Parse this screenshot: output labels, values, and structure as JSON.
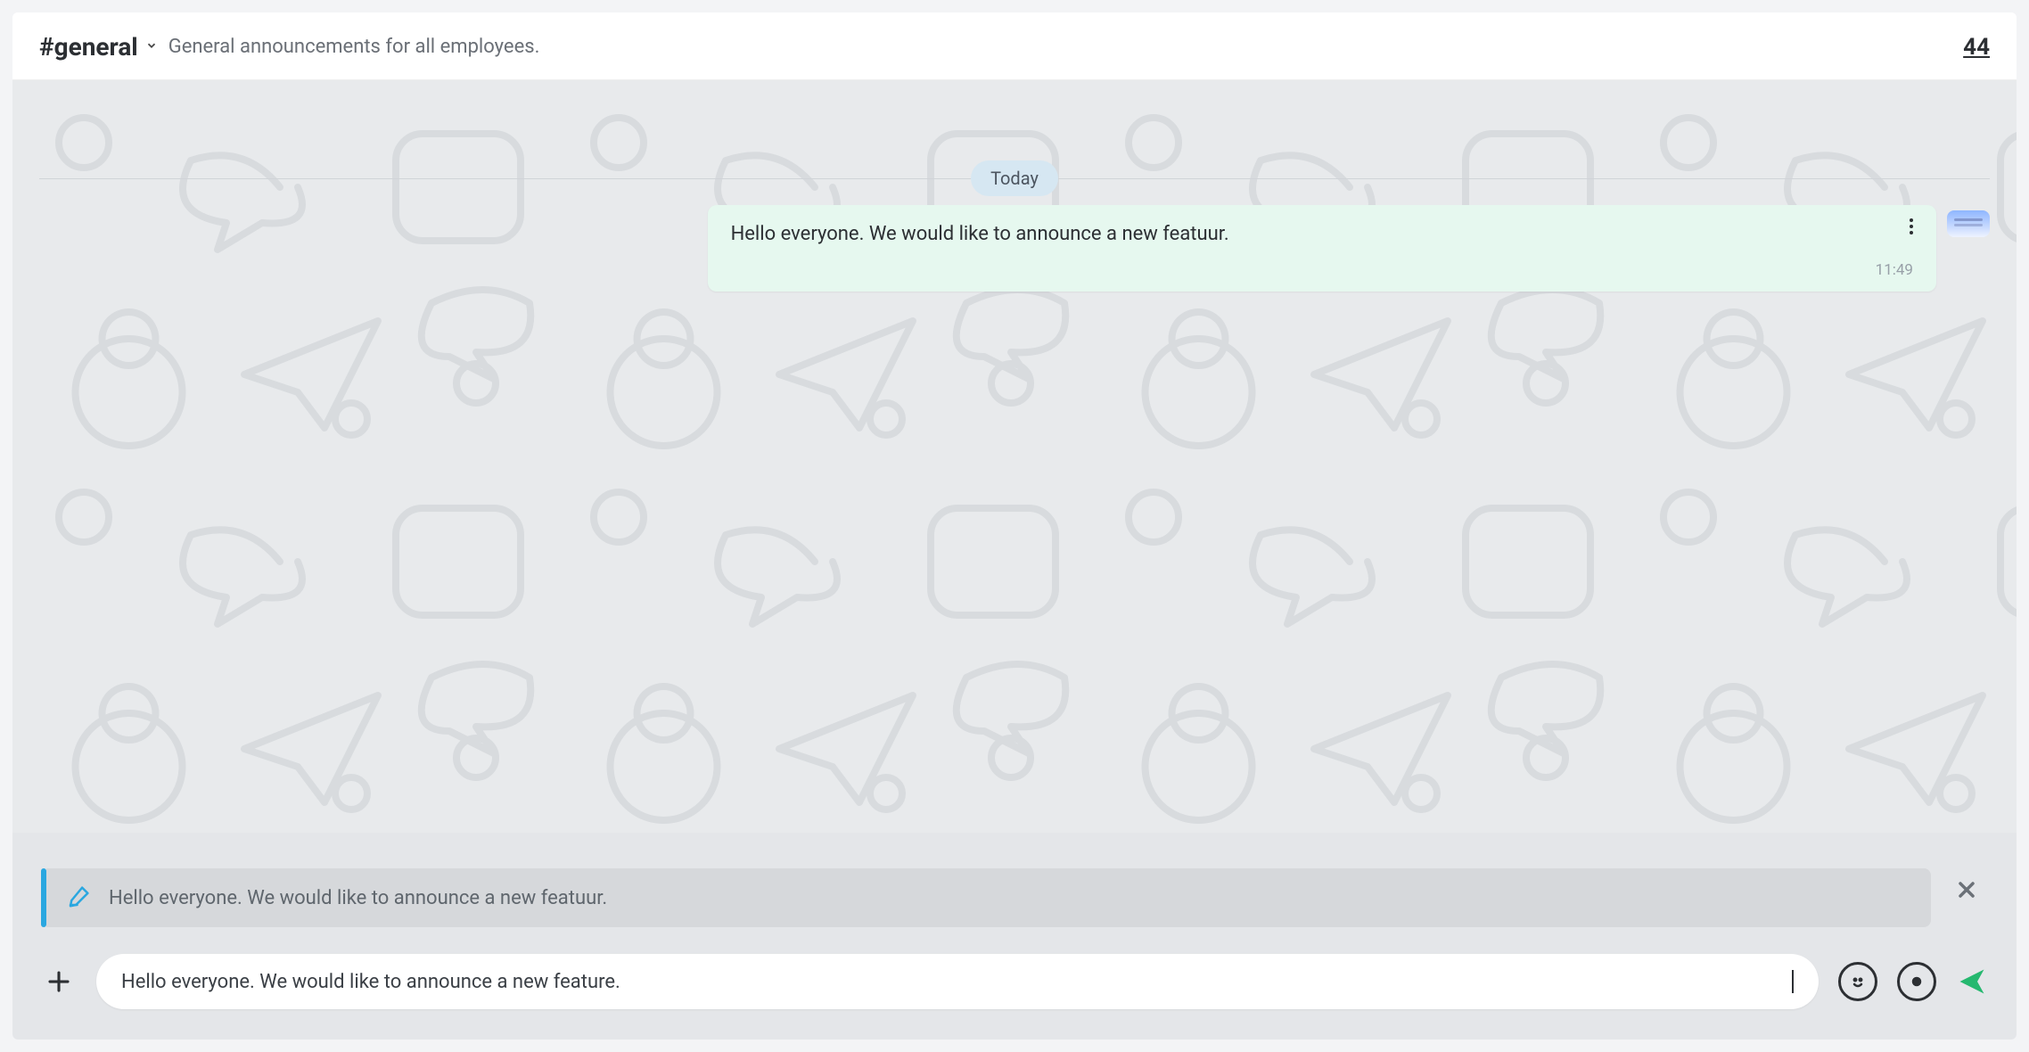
{
  "header": {
    "channel_name": "#general",
    "topic": "General announcements for all employees.",
    "member_count": "44"
  },
  "divider": {
    "label": "Today"
  },
  "message": {
    "text": "Hello everyone. We would like to announce a new featuur.",
    "time": "11:49"
  },
  "edit_preview": {
    "text": "Hello everyone. We would like to announce a new featuur."
  },
  "composer": {
    "value": "Hello everyone. We would like to announce a new feature."
  },
  "icons": {
    "chevron_down": "chevron-down-icon",
    "kebab": "kebab-icon",
    "pencil": "pencil-edit-icon",
    "close": "close-icon",
    "plus": "plus-icon",
    "smile": "emoji-icon",
    "record": "record-icon",
    "send": "send-icon"
  }
}
